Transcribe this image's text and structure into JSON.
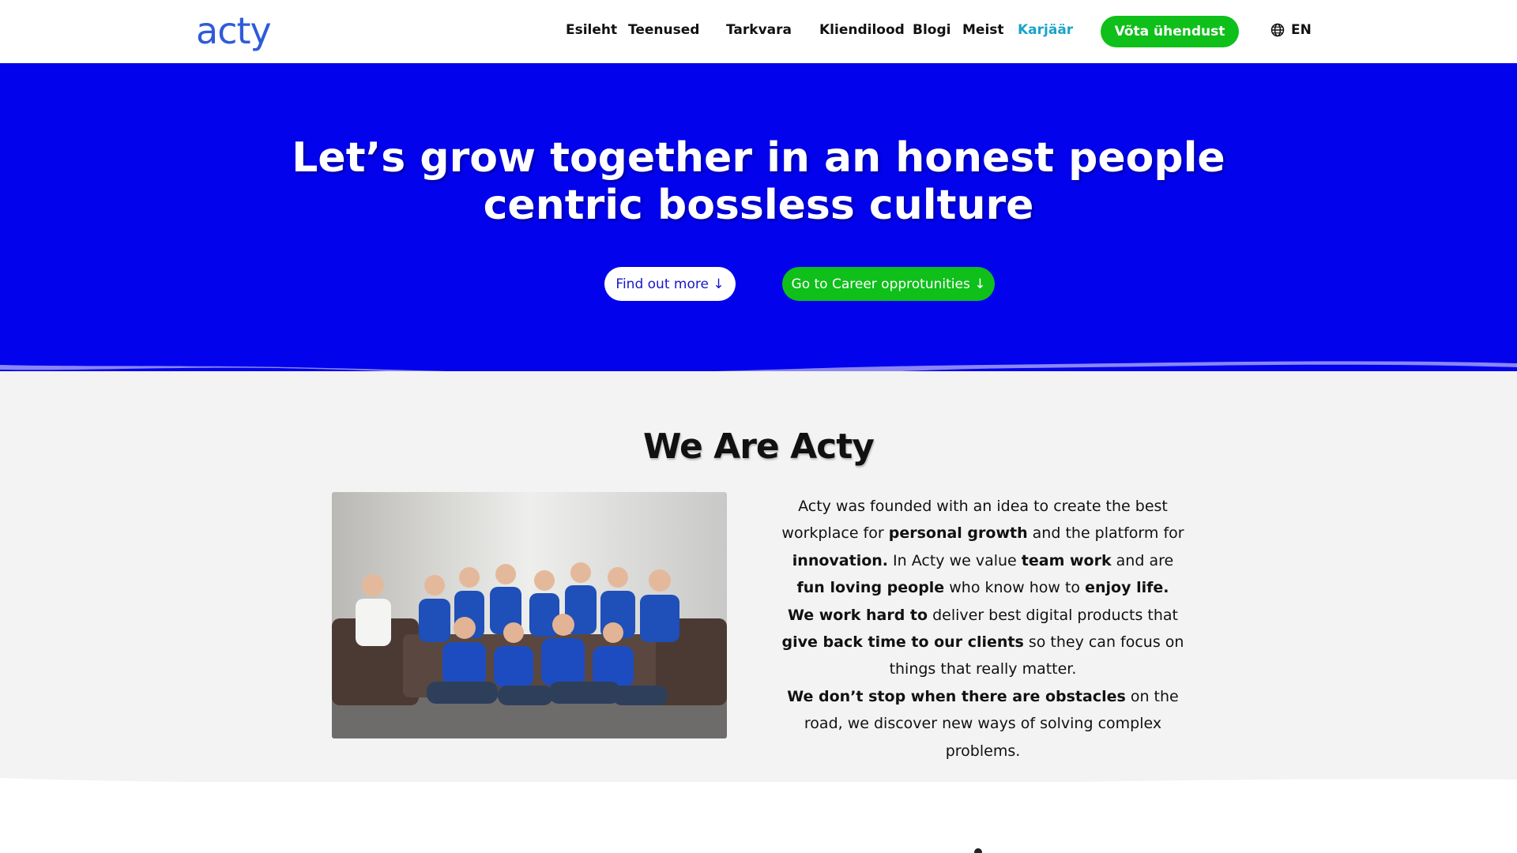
{
  "header": {
    "logo": "acty",
    "nav": [
      {
        "label": "Esileht"
      },
      {
        "label": "Teenused"
      },
      {
        "label": "Tarkvara"
      },
      {
        "label": "Kliendilood"
      },
      {
        "label": "Blogi"
      },
      {
        "label": "Meist"
      },
      {
        "label": "Karjäär"
      }
    ],
    "cta_label": "Võta ühendust",
    "lang_label": "EN",
    "colors": {
      "accent": "#0fbf1a",
      "active_nav": "#1aa3c8",
      "logo": "#2f5bd8"
    }
  },
  "hero": {
    "title_line1": "Let’s grow together in an honest people",
    "title_line2": "centric bossless culture",
    "find_out_more": "Find out more ↓",
    "career_button": "Go to Career opprotunities ↓",
    "background": "#0202ec"
  },
  "about": {
    "title": "We Are Acty",
    "p1": [
      {
        "t": "Acty was founded with an idea to create the best workplace for ",
        "b": false
      },
      {
        "t": "personal growth",
        "b": true
      },
      {
        "t": " and the platform for ",
        "b": false
      },
      {
        "t": "innovation.",
        "b": true
      },
      {
        "t": " In Acty we value ",
        "b": false
      },
      {
        "t": "team work",
        "b": true
      },
      {
        "t": " and are ",
        "b": false
      },
      {
        "t": "fun loving people",
        "b": true
      },
      {
        "t": " who know how to ",
        "b": false
      },
      {
        "t": "enjoy life.",
        "b": true
      }
    ],
    "p2": [
      {
        "t": "We work hard to",
        "b": true
      },
      {
        "t": " deliver best digital products that ",
        "b": false
      },
      {
        "t": "give back time to our clients",
        "b": true
      },
      {
        "t": " so they can focus on things that really matter.",
        "b": false
      }
    ],
    "p3": [
      {
        "t": "We don’t stop when there are obstacles",
        "b": true
      },
      {
        "t": " on the road, we discover new ways of solving complex problems.",
        "b": false
      }
    ]
  }
}
